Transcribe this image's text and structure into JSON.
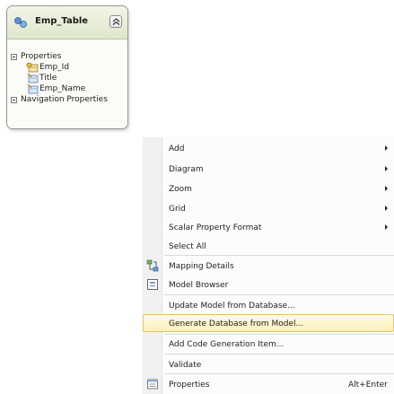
{
  "entity": {
    "title": "Emp_Table",
    "sections": {
      "properties_label": "Properties",
      "navigation_label": "Navigation Properties"
    },
    "properties": [
      {
        "name": "Emp_Id",
        "icon": "key-property-icon"
      },
      {
        "name": "Title",
        "icon": "property-icon"
      },
      {
        "name": "Emp_Name",
        "icon": "property-icon"
      }
    ]
  },
  "context_menu": {
    "items": {
      "add": "Add",
      "diagram": "Diagram",
      "zoom": "Zoom",
      "grid": "Grid",
      "scalar_property_format": "Scalar Property Format",
      "select_all": "Select All",
      "mapping_details": "Mapping Details",
      "model_browser": "Model Browser",
      "update_model": "Update Model from Database...",
      "generate_database": "Generate Database from Model...",
      "add_code_generation": "Add Code Generation Item...",
      "validate": "Validate",
      "properties": "Properties"
    },
    "properties_shortcut": "Alt+Enter",
    "highlighted_item": "Generate Database from Model...",
    "colors": {
      "highlight_fill": "#fff0b8",
      "highlight_border": "#e5c365",
      "entity_header": "#dfe6c9"
    }
  }
}
